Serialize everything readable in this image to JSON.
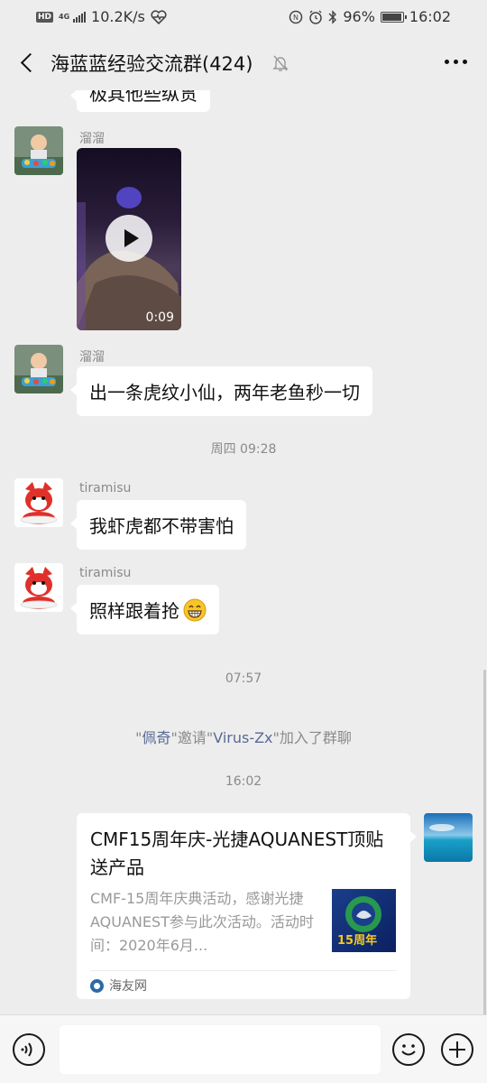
{
  "status_bar": {
    "hd": "HD",
    "network": "4G",
    "speed": "10.2K/s",
    "battery": "96%",
    "battery_level": 0.96,
    "time": "16:02"
  },
  "header": {
    "title": "海蓝蓝经验交流群(424)"
  },
  "messages": {
    "partial_text": "极其他些纵贯",
    "m1": {
      "sender": "溜溜",
      "video_duration": "0:09"
    },
    "m2": {
      "sender": "溜溜",
      "text": "出一条虎纹小仙，两年老鱼秒一切"
    },
    "time1": "周四 09:28",
    "m3": {
      "sender": "tiramisu",
      "text": "我虾虎都不带害怕"
    },
    "m4": {
      "sender": "tiramisu",
      "text": "照样跟着抢"
    },
    "time2": "07:57",
    "system": {
      "q_open": "\"",
      "inviter": "佩奇",
      "q_mid": "\"邀请\"",
      "invitee": "Virus-Zx",
      "q_close": "\"加入了群聊"
    },
    "time3": "16:02",
    "link": {
      "title": "CMF15周年庆-光捷AQUANEST顶贴送产品",
      "desc": "CMF-15周年庆典活动，感谢光捷AQUANEST参与此次活动。活动时间：2020年6月...",
      "thumb_text": "15周年",
      "source": "海友网"
    }
  },
  "input": {
    "placeholder": ""
  },
  "colors": {
    "background": "#ededed",
    "bubble": "#ffffff",
    "link_name": "#586b95"
  }
}
